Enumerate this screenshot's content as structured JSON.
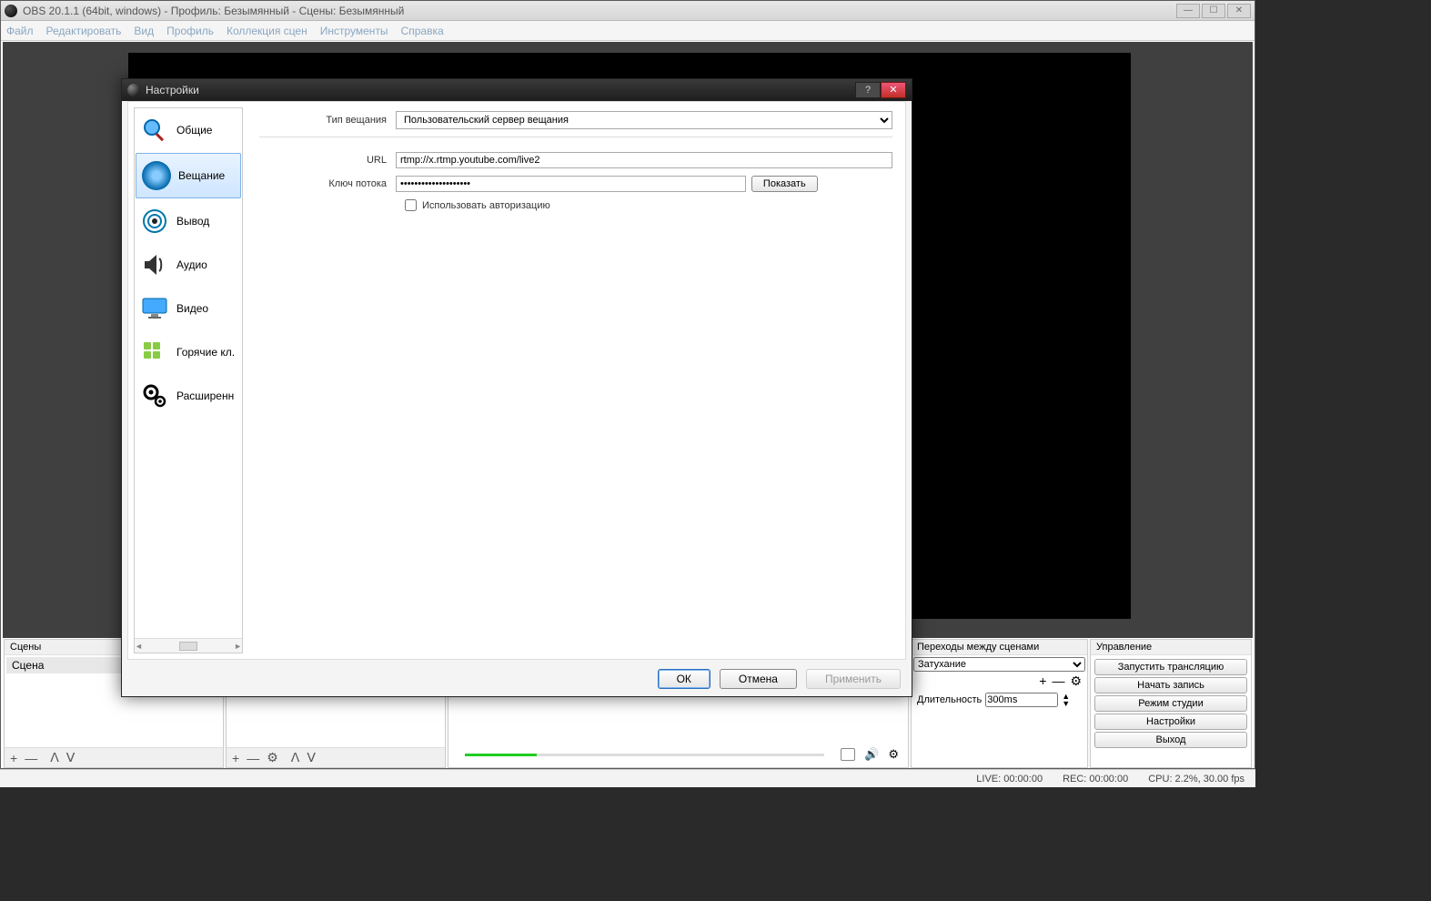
{
  "window": {
    "title": "OBS 20.1.1 (64bit, windows) - Профиль: Безымянный - Сцены: Безымянный",
    "min": "—",
    "max": "☐",
    "close": "✕"
  },
  "menu": {
    "file": "Файл",
    "edit": "Редактировать",
    "view": "Вид",
    "profile": "Профиль",
    "scenes": "Коллекция сцен",
    "tools": "Инструменты",
    "help": "Справка"
  },
  "panels": {
    "scenes_header": "Сцены",
    "scene_item": "Сцена",
    "sources_header": "",
    "transitions_header": "Переходы между сценами",
    "controls_header": "Управление",
    "duration_label": "Длительность",
    "duration_value": "300ms",
    "transition_select": "Затухание",
    "tb_plus": "+",
    "tb_minus": "—",
    "tb_up": "ᐱ",
    "tb_down": "ᐯ",
    "tb_gear": "⚙"
  },
  "mixer": {
    "mic_icon": "🎤",
    "spk_icon": "🔊",
    "gear": "⚙"
  },
  "controls": {
    "start_stream": "Запустить трансляцию",
    "start_record": "Начать запись",
    "studio_mode": "Режим студии",
    "settings": "Настройки",
    "exit": "Выход"
  },
  "status": {
    "live": "LIVE: 00:00:00",
    "rec": "REC: 00:00:00",
    "cpu": "CPU: 2.2%, 30.00 fps"
  },
  "dialog": {
    "title": "Настройки",
    "help_btn": "?",
    "close_btn": "✕",
    "sidebar": {
      "general": "Общие",
      "stream": "Вещание",
      "output": "Вывод",
      "audio": "Аудио",
      "video": "Видео",
      "hotkeys": "Горячие кл.",
      "advanced": "Расширенн"
    },
    "scroll_marker": "‹  ⁞⁞⁞  ›",
    "form": {
      "stream_type_label": "Тип вещания",
      "stream_type_value": "Пользовательский сервер вещания",
      "url_label": "URL",
      "url_value": "rtmp://x.rtmp.youtube.com/live2",
      "key_label": "Ключ потока",
      "key_value": "••••••••••••••••••••",
      "show_btn": "Показать",
      "use_auth": "Использовать авторизацию"
    },
    "buttons": {
      "ok": "ОК",
      "cancel": "Отмена",
      "apply": "Применить"
    }
  }
}
